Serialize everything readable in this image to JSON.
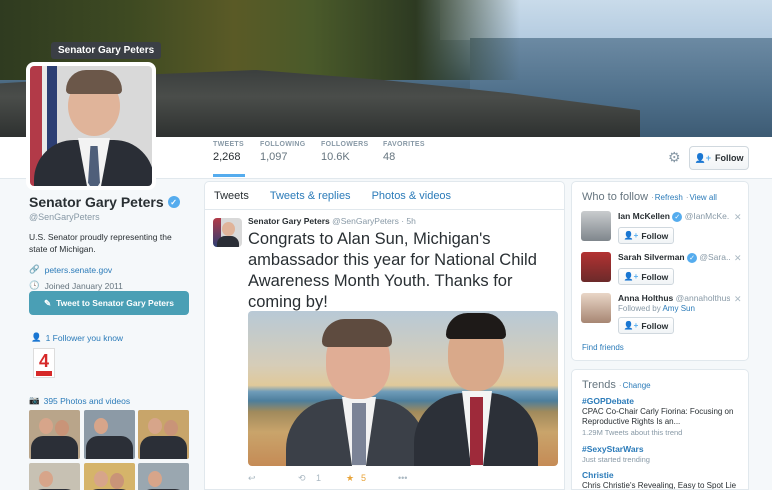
{
  "profile": {
    "tooltip": "Senator Gary Peters",
    "name": "Senator Gary Peters",
    "handle": "@SenGaryPeters",
    "bio": "U.S. Senator proudly representing the state of Michigan.",
    "website": "peters.senate.gov",
    "joined": "Joined January 2011",
    "tweet_to_label": "Tweet to Senator Gary Peters",
    "followers_you_know": "1 Follower you know",
    "photos_videos": "395 Photos and videos",
    "wdiv_logo_text": "4"
  },
  "stats": [
    {
      "label": "TWEETS",
      "value": "2,268"
    },
    {
      "label": "FOLLOWING",
      "value": "1,097"
    },
    {
      "label": "FOLLOWERS",
      "value": "10.6K"
    },
    {
      "label": "FAVORITES",
      "value": "48"
    }
  ],
  "header": {
    "follow_label": "Follow",
    "gear_icon": "gear-icon"
  },
  "timeline": {
    "tabs": [
      "Tweets",
      "Tweets & replies",
      "Photos & videos"
    ],
    "tweet": {
      "author": "Senator Gary Peters",
      "handle": "@SenGaryPeters",
      "time": "· 5h",
      "text": "Congrats to Alan Sun, Michigan's ambassador this year for National Child Awareness Month Youth. Thanks for coming by!",
      "retweets": "1",
      "favorites": "5"
    }
  },
  "who_to_follow": {
    "title": "Who to follow",
    "refresh": "Refresh",
    "view_all": "View all",
    "follow_label": "Follow",
    "items": [
      {
        "name": "Ian McKellen",
        "handle": "@IanMcKe..."
      },
      {
        "name": "Sarah Silverman",
        "handle": "@Sara..."
      },
      {
        "name": "Anna Holthus",
        "handle": "@annaholthus",
        "followed_by": "Followed by",
        "followed_by_name": "Amy Sun"
      }
    ],
    "find_friends": "Find friends"
  },
  "trends": {
    "title": "Trends",
    "change": "Change",
    "items": [
      {
        "name": "#GOPDebate",
        "desc": "CPAC Co-Chair Carly Fiorina: Focusing on Reproductive Rights Is an...",
        "count": "1.29M Tweets about this trend"
      },
      {
        "name": "#SexyStarWars",
        "desc": "",
        "count": "Just started trending"
      },
      {
        "name": "Christie",
        "desc": "Chris Christie's Revealing, Easy to Spot Lie",
        "count": ""
      }
    ]
  },
  "colors": {
    "accent": "#55acee",
    "link": "#2b7bb9",
    "tweet_button": "#4a9fb5",
    "favorite_star": "#e8a43a"
  }
}
